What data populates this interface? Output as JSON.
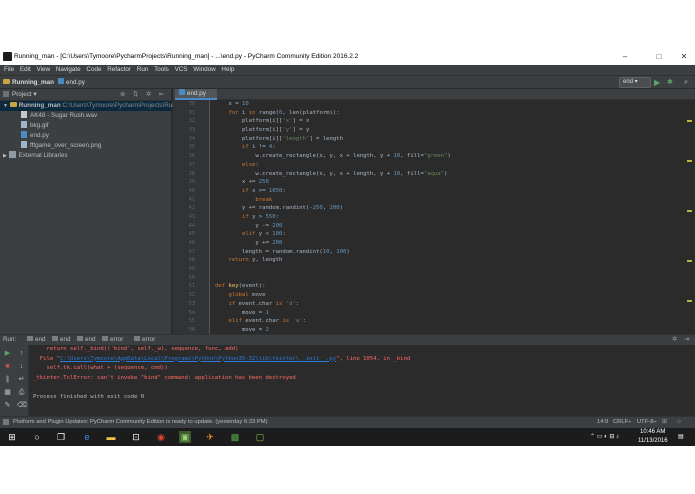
{
  "window": {
    "title": "Running_man - [C:\\Users\\Tymoore\\PycharmProjects\\Running_man] - ...\\end.py - PyCharm Community Edition 2016.2.2",
    "minimize": "–",
    "maximize": "□",
    "close": "✕"
  },
  "menu": [
    "File",
    "Edit",
    "View",
    "Navigate",
    "Code",
    "Refactor",
    "Run",
    "Tools",
    "VCS",
    "Window",
    "Help"
  ],
  "breadcrumb": {
    "project": "Running_man",
    "file": "end.py"
  },
  "run_config": {
    "label": "end ▾"
  },
  "project_panel": {
    "title": "Project ▾",
    "root": "Running_man",
    "root_path": "C:\\Users\\Tymoore\\PycharmProjects\\Run",
    "files": [
      "AK48 - Sugar Rush.wav",
      "bkg.gif",
      "end.py",
      "fftgame_over_screen.png"
    ],
    "external": "External Libraries"
  },
  "editor": {
    "tab": "end.py",
    "line_numbers": [
      30,
      31,
      32,
      33,
      34,
      35,
      36,
      37,
      38,
      39,
      40,
      41,
      42,
      43,
      44,
      45,
      46,
      47,
      48,
      49,
      50,
      51,
      52,
      53,
      54,
      55,
      56,
      57,
      58,
      59,
      60
    ],
    "lines": [
      [
        {
          "t": "    x = ",
          "c": ""
        },
        {
          "t": "10",
          "c": "num"
        }
      ],
      [
        {
          "t": "    ",
          "c": ""
        },
        {
          "t": "for",
          "c": "kw"
        },
        {
          "t": " i ",
          "c": ""
        },
        {
          "t": "in",
          "c": "kw"
        },
        {
          "t": " range(",
          "c": ""
        },
        {
          "t": "0",
          "c": "num"
        },
        {
          "t": ", len(platform)):",
          "c": ""
        }
      ],
      [
        {
          "t": "        platform[i][",
          "c": ""
        },
        {
          "t": "'x'",
          "c": "str"
        },
        {
          "t": "] = x",
          "c": ""
        }
      ],
      [
        {
          "t": "        platform[i][",
          "c": ""
        },
        {
          "t": "'y'",
          "c": "str"
        },
        {
          "t": "] = y",
          "c": ""
        }
      ],
      [
        {
          "t": "        platform[i][",
          "c": ""
        },
        {
          "t": "'length'",
          "c": "str"
        },
        {
          "t": "] = length",
          "c": ""
        }
      ],
      [
        {
          "t": "        ",
          "c": ""
        },
        {
          "t": "if",
          "c": "kw"
        },
        {
          "t": " i != ",
          "c": ""
        },
        {
          "t": "4",
          "c": "num"
        },
        {
          "t": ":",
          "c": ""
        }
      ],
      [
        {
          "t": "            w.create_rectangle(x, y, x + length, y + ",
          "c": ""
        },
        {
          "t": "10",
          "c": "num"
        },
        {
          "t": ", fill=",
          "c": ""
        },
        {
          "t": "\"green\"",
          "c": "str"
        },
        {
          "t": ")",
          "c": ""
        }
      ],
      [
        {
          "t": "        ",
          "c": ""
        },
        {
          "t": "else",
          "c": "kw"
        },
        {
          "t": ":",
          "c": ""
        }
      ],
      [
        {
          "t": "            w.create_rectangle(x, y, x + length, y + ",
          "c": ""
        },
        {
          "t": "10",
          "c": "num"
        },
        {
          "t": ", fill=",
          "c": ""
        },
        {
          "t": "\"aqua\"",
          "c": "str"
        },
        {
          "t": ")",
          "c": ""
        }
      ],
      [
        {
          "t": "        x += ",
          "c": ""
        },
        {
          "t": "250",
          "c": "num"
        }
      ],
      [
        {
          "t": "        ",
          "c": ""
        },
        {
          "t": "if",
          "c": "kw"
        },
        {
          "t": " x >= ",
          "c": ""
        },
        {
          "t": "1050",
          "c": "num"
        },
        {
          "t": ":",
          "c": ""
        }
      ],
      [
        {
          "t": "            ",
          "c": ""
        },
        {
          "t": "break",
          "c": "kw"
        }
      ],
      [
        {
          "t": "        y += random.randint(-",
          "c": ""
        },
        {
          "t": "250",
          "c": "num"
        },
        {
          "t": ", ",
          "c": ""
        },
        {
          "t": "200",
          "c": "num"
        },
        {
          "t": ")",
          "c": ""
        }
      ],
      [
        {
          "t": "        ",
          "c": ""
        },
        {
          "t": "if",
          "c": "kw"
        },
        {
          "t": " y > ",
          "c": ""
        },
        {
          "t": "550",
          "c": "num"
        },
        {
          "t": ":",
          "c": ""
        }
      ],
      [
        {
          "t": "            y -= ",
          "c": ""
        },
        {
          "t": "200",
          "c": "num"
        }
      ],
      [
        {
          "t": "        ",
          "c": ""
        },
        {
          "t": "elif",
          "c": "kw"
        },
        {
          "t": " y < ",
          "c": ""
        },
        {
          "t": "100",
          "c": "num"
        },
        {
          "t": ":",
          "c": ""
        }
      ],
      [
        {
          "t": "            y += ",
          "c": ""
        },
        {
          "t": "200",
          "c": "num"
        }
      ],
      [
        {
          "t": "        length = random.randint(",
          "c": ""
        },
        {
          "t": "10",
          "c": "num"
        },
        {
          "t": ", ",
          "c": ""
        },
        {
          "t": "100",
          "c": "num"
        },
        {
          "t": ")",
          "c": ""
        }
      ],
      [
        {
          "t": "    ",
          "c": ""
        },
        {
          "t": "return",
          "c": "kw"
        },
        {
          "t": " y, length",
          "c": ""
        }
      ],
      [
        {
          "t": "",
          "c": ""
        }
      ],
      [
        {
          "t": "",
          "c": ""
        }
      ],
      [
        {
          "t": "def",
          "c": "kw"
        },
        {
          "t": " ",
          "c": ""
        },
        {
          "t": "key",
          "c": "fn"
        },
        {
          "t": "(event):",
          "c": ""
        }
      ],
      [
        {
          "t": "    ",
          "c": ""
        },
        {
          "t": "global",
          "c": "kw"
        },
        {
          "t": " move",
          "c": ""
        }
      ],
      [
        {
          "t": "    ",
          "c": ""
        },
        {
          "t": "if",
          "c": "kw"
        },
        {
          "t": " event.char ",
          "c": ""
        },
        {
          "t": "is",
          "c": "kw"
        },
        {
          "t": " ",
          "c": ""
        },
        {
          "t": "'d'",
          "c": "str"
        },
        {
          "t": ":",
          "c": ""
        }
      ],
      [
        {
          "t": "        move = ",
          "c": ""
        },
        {
          "t": "1",
          "c": "num"
        }
      ],
      [
        {
          "t": "    ",
          "c": ""
        },
        {
          "t": "elif",
          "c": "kw"
        },
        {
          "t": " event.char ",
          "c": ""
        },
        {
          "t": "is",
          "c": "kw"
        },
        {
          "t": " ",
          "c": ""
        },
        {
          "t": "'a'",
          "c": "str"
        },
        {
          "t": ":",
          "c": ""
        }
      ],
      [
        {
          "t": "        move = ",
          "c": ""
        },
        {
          "t": "2",
          "c": "num"
        }
      ],
      [
        {
          "t": "    ",
          "c": ""
        },
        {
          "t": "elif",
          "c": "kw"
        },
        {
          "t": " event.char ",
          "c": ""
        },
        {
          "t": "is",
          "c": "kw"
        },
        {
          "t": " ",
          "c": ""
        },
        {
          "t": "'w'",
          "c": "str"
        },
        {
          "t": ":",
          "c": ""
        }
      ]
    ]
  },
  "run_panel": {
    "label": "Run:",
    "tabs": [
      "end",
      "end",
      "end",
      "error",
      "error"
    ],
    "console": [
      [
        {
          "t": "    return self._bind(('bind', self._w), sequence, func, add)",
          "c": "err"
        }
      ],
      [
        {
          "t": "  File \"",
          "c": "err"
        },
        {
          "t": "C:\\Users\\Tymoore\\AppData\\Local\\Programs\\Python\\Python35-32\\lib\\tkinter\\__init__.py",
          "c": "link"
        },
        {
          "t": "\", line 1054, in _bind",
          "c": "err"
        }
      ],
      [
        {
          "t": "    self.tk.call(what + (sequence, cmd))",
          "c": "err"
        }
      ],
      [
        {
          "t": "_tkinter.TclError: can't invoke \"bind\" command: application has been destroyed",
          "c": "err"
        }
      ],
      [
        {
          "t": "",
          "c": "out"
        }
      ],
      [
        {
          "t": "Process finished with exit code 0",
          "c": "out"
        }
      ]
    ]
  },
  "status_bar": {
    "message": "Platform and Plugin Updates: PyCharm Community Edition is ready to update. (yesterday 6:33 PM)",
    "position": "14:9",
    "line_sep": "CRLF÷",
    "encoding": "UTF-8÷"
  },
  "taskbar": {
    "time": "10:46 AM",
    "date": "11/13/2016"
  }
}
